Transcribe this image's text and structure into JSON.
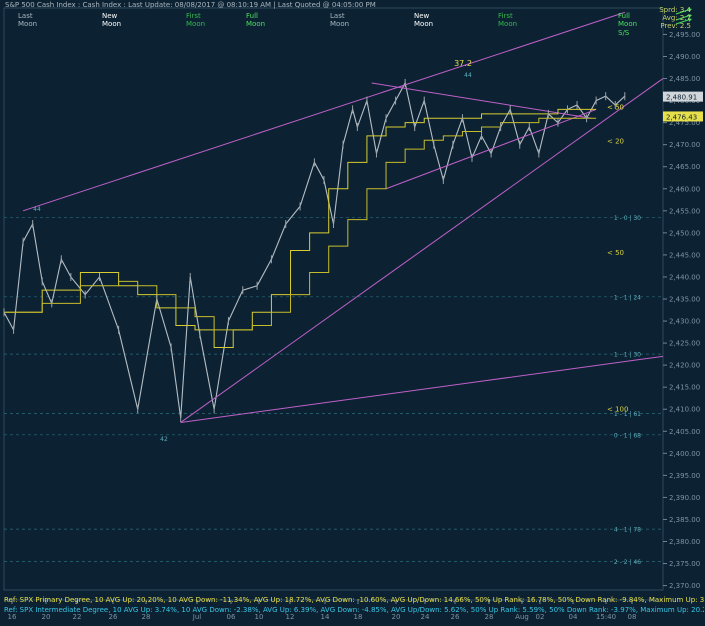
{
  "header": {
    "title": "S&P 500 Cash Index : Cash Index : Last Update: 08/08/2017 @ 08:10:19 AM | Last Quoted @ 04:05:00 PM"
  },
  "moons": [
    {
      "l1": "Last",
      "l2": "Moon",
      "color": "#a9b6bf"
    },
    {
      "l1": "New",
      "l2": "Moon",
      "color": "#ffffff"
    },
    {
      "l1": "First",
      "l2": "Moon",
      "color": "#35b84a"
    },
    {
      "l1": "Full",
      "l2": "Moon",
      "color": "#48e05a"
    },
    {
      "l1": "Last",
      "l2": "Moon",
      "color": "#a9b6bf"
    },
    {
      "l1": "New",
      "l2": "Moon",
      "color": "#ffffff"
    },
    {
      "l1": "First",
      "l2": "Moon",
      "color": "#35b84a"
    },
    {
      "l1": "Full",
      "l2": "Moon",
      "color": "#48e05a"
    }
  ],
  "stats": {
    "sprd": "Sprd: 3.4",
    "avg": "Avg: 2.7",
    "prev": "Prev: 2.5",
    "extra": "S/S"
  },
  "annotations": {
    "peak_value": "37.2",
    "wave_top": "44",
    "wave_left": "44",
    "wave_low": "42"
  },
  "levels": [
    {
      "label": "< 50",
      "color": "#e8e04a",
      "y": 2478.5
    },
    {
      "label": "< 20",
      "color": "#d9cf3c",
      "y": 2470.8
    },
    {
      "label": "< 50",
      "color": "#d9cf3c",
      "y": 2445.5
    },
    {
      "label": "< 100",
      "color": "#d9cf3c",
      "y": 2410.0
    }
  ],
  "fib_labels": [
    {
      "label": "1 - 0 | 30",
      "y": 2453.5
    },
    {
      "label": "1 - 1 | 24",
      "y": 2435.5
    },
    {
      "label": "1 - 1 | 30",
      "y": 2422.5
    },
    {
      "label": "1 - 1 | 61",
      "y": 2409.0
    },
    {
      "label": "0 - 1 | 68",
      "y": 2404.2
    },
    {
      "label": "4 - 1 | 78",
      "y": 2382.8
    },
    {
      "label": "2 - 2 | 46",
      "y": 2375.5
    }
  ],
  "price_tags": [
    {
      "label": "2,480.91",
      "y": 2480.9
    },
    {
      "label": "2,476.43",
      "y": 2476.4
    }
  ],
  "chart_data": {
    "type": "line",
    "ylim": [
      2369,
      2501
    ],
    "y_ticks": [
      "2,495.00",
      "2,490.00",
      "2,485.00",
      "2,480.00",
      "2,475.00",
      "2,470.00",
      "2,465.00",
      "2,460.00",
      "2,455.00",
      "2,450.00",
      "2,445.00",
      "2,440.00",
      "2,435.00",
      "2,430.00",
      "2,425.00",
      "2,420.00",
      "2,415.00",
      "2,410.00",
      "2,405.00",
      "2,400.00",
      "2,395.00",
      "2,390.00",
      "2,385.00",
      "2,380.00",
      "2,375.00",
      "2,370.00"
    ],
    "x_ticks": [
      "16",
      "20",
      "22",
      "26",
      "28",
      "Jul",
      "06",
      "10",
      "12",
      "14",
      "18",
      "20",
      "24",
      "26",
      "28",
      "Aug",
      "02",
      "04",
      "15:40",
      "08"
    ],
    "series": [
      {
        "name": "price",
        "x": [
          0,
          2,
          4,
          6,
          8,
          10,
          12,
          14,
          17,
          20,
          24,
          28,
          32,
          35,
          37,
          39,
          41,
          44,
          47,
          50,
          53,
          56,
          59,
          62,
          65,
          67,
          69,
          71,
          73,
          74,
          76,
          78,
          80,
          82,
          84,
          86,
          88,
          90,
          92,
          94,
          96,
          98,
          100,
          102,
          104,
          106,
          108,
          110,
          112,
          114,
          116,
          118,
          120,
          122,
          124,
          126,
          128,
          130
        ],
        "y": [
          2432,
          2428,
          2448,
          2452,
          2439,
          2434,
          2444,
          2440,
          2436,
          2440,
          2428,
          2410,
          2435,
          2424,
          2408,
          2440,
          2427,
          2410,
          2430,
          2437,
          2438,
          2444,
          2452,
          2456,
          2466,
          2462,
          2452,
          2470,
          2478,
          2474,
          2480,
          2468,
          2476,
          2480,
          2484,
          2474,
          2480,
          2470,
          2462,
          2470,
          2476,
          2467,
          2472,
          2468,
          2474,
          2478,
          2470,
          2474,
          2468,
          2477,
          2475,
          2478,
          2479,
          2476,
          2480,
          2481,
          2479,
          2481
        ]
      },
      {
        "name": "upper trend",
        "x": [
          4,
          130
        ],
        "y": [
          2455,
          2500
        ]
      },
      {
        "name": "lower trend",
        "x": [
          37,
          138
        ],
        "y": [
          2407,
          2485
        ]
      },
      {
        "name": "bottom channel",
        "x": [
          37,
          138
        ],
        "y": [
          2407,
          2422
        ]
      },
      {
        "name": "wedge top",
        "x": [
          77,
          123
        ],
        "y": [
          2484,
          2476
        ]
      },
      {
        "name": "wedge bottom",
        "x": [
          80,
          124
        ],
        "y": [
          2460,
          2478
        ]
      },
      {
        "name": "ma fast",
        "x": [
          0,
          8,
          16,
          24,
          28,
          32,
          36,
          40,
          44,
          48,
          52,
          56,
          60,
          64,
          68,
          72,
          76,
          80,
          84,
          88,
          92,
          96,
          100,
          104,
          108,
          112,
          116,
          120,
          124
        ],
        "y": [
          2432,
          2437,
          2441,
          2438,
          2436,
          2433,
          2429,
          2428,
          2424,
          2428,
          2432,
          2436,
          2446,
          2450,
          2460,
          2466,
          2472,
          2474,
          2475,
          2476,
          2476,
          2476,
          2477,
          2477,
          2477,
          2477,
          2478,
          2478,
          2478
        ]
      },
      {
        "name": "ma slow",
        "x": [
          0,
          8,
          16,
          24,
          28,
          32,
          36,
          40,
          44,
          48,
          52,
          56,
          60,
          64,
          68,
          72,
          76,
          80,
          84,
          88,
          92,
          96,
          100,
          104,
          108,
          112,
          116,
          120,
          124
        ],
        "y": [
          2432,
          2434,
          2438,
          2439,
          2438,
          2436,
          2433,
          2431,
          2428,
          2428,
          2429,
          2432,
          2436,
          2441,
          2447,
          2453,
          2460,
          2466,
          2469,
          2471,
          2472,
          2473,
          2474,
          2475,
          2475,
          2476,
          2476,
          2476,
          2476
        ]
      }
    ]
  },
  "ref_lines": [
    {
      "text": "Ref: SPX Primary Degree, 10 AVG Up: 20.20%, 10 AVG Down: -11.34%, AVG Up: 18.72%, AVG Down: -10.60%, AVG Up/Down: 14.66%, 50%  Up Rank: 16.78%, 50% Down Rank: -9.84%, Maximum Up: 37.23%, Maximum",
      "color": "#e8e04a"
    },
    {
      "text": "Ref: SPX Intermediate Degree, 10 AVG Up: 3.74%, 10 AVG Down: -2.38%, AVG Up: 6.39%, AVG Down: -4.85%, AVG Up/Down: 5.62%, 50%  Up Rank: 5.59%, 50% Down Rank: -3.97%, Maximum Up: 20.27%, Maximum Do",
      "color": "#37c8e6"
    }
  ]
}
